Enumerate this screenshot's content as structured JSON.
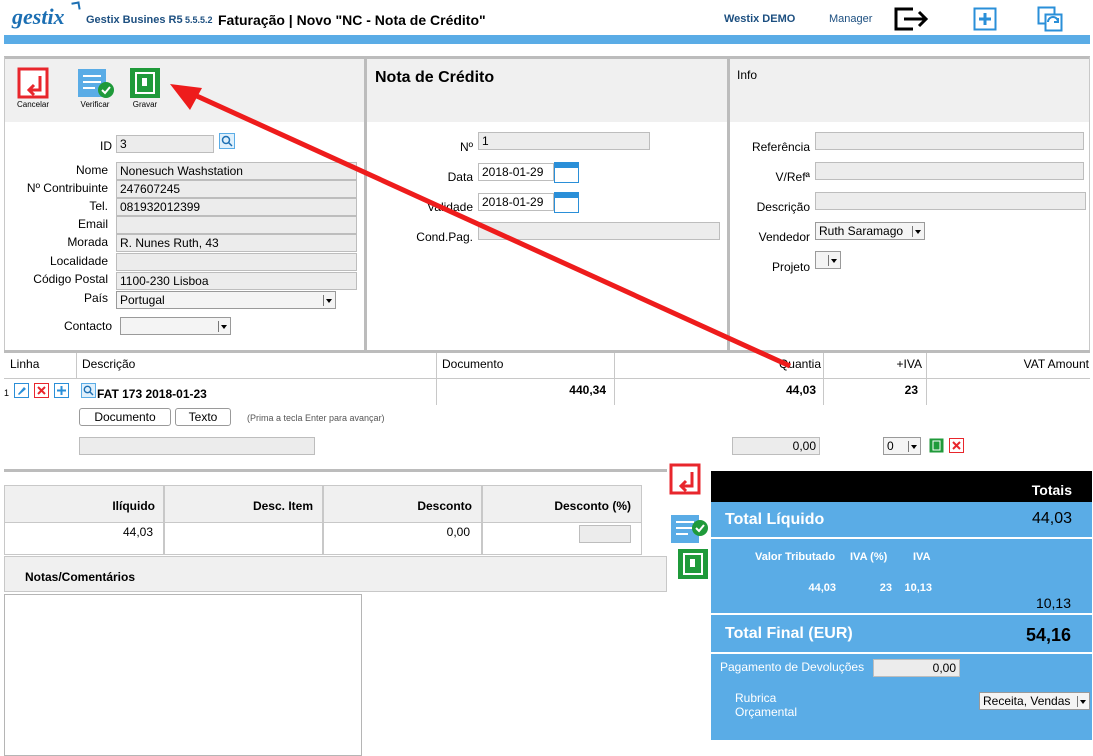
{
  "header": {
    "logo": "gestix",
    "app_name": "Gestix Busines R5",
    "version": "5.5.5.2",
    "title": "Faturação | Novo \"NC - Nota de Crédito\"",
    "company": "Westix DEMO",
    "user": "Manager"
  },
  "toolbar": {
    "cancel_label": "Cancelar",
    "verify_label": "Verificar",
    "save_label": "Gravar"
  },
  "doc_section": {
    "title": "Nota de Crédito"
  },
  "info_section": {
    "title": "Info"
  },
  "customer": {
    "id_label": "ID",
    "id_value": "3",
    "name_label": "Nome",
    "name_value": "Nonesuch Washstation",
    "nif_label": "Nº Contribuinte",
    "nif_value": "247607245",
    "tel_label": "Tel.",
    "tel_value": "081932012399",
    "email_label": "Email",
    "email_value": "",
    "address_label": "Morada",
    "address_value": "R. Nunes Ruth, 43",
    "city_label": "Localidade",
    "city_value": "",
    "zip_label": "Código Postal",
    "zip_value": "1100-230 Lisboa",
    "country_label": "País",
    "country_value": "Portugal",
    "contact_label": "Contacto",
    "contact_value": ""
  },
  "document": {
    "number_label": "Nº",
    "number_value": "1",
    "date_label": "Data",
    "date_value": "2018-01-29",
    "validity_label": "Validade",
    "validity_value": "2018-01-29",
    "payment_label": "Cond.Pag.",
    "payment_value": ""
  },
  "info": {
    "reference_label": "Referência",
    "vref_label": "V/Refª",
    "description_label": "Descrição",
    "seller_label": "Vendedor",
    "seller_value": "Ruth Saramago",
    "project_label": "Projeto",
    "project_value": ""
  },
  "lines": {
    "headers": {
      "line": "Linha",
      "description": "Descrição",
      "document": "Documento",
      "quantity": "Quantia",
      "vat": "+IVA",
      "vat_amount": "VAT Amount"
    },
    "rows": [
      {
        "number": "1",
        "description": "FAT 173 2018-01-23",
        "document": "440,34",
        "quantity": "44,03",
        "vat": "23"
      }
    ],
    "doc_button": "Documento",
    "text_button": "Texto",
    "hint": "(Prima a tecla Enter para avançar)",
    "new_amount": "0,00",
    "new_vat": "0"
  },
  "summary": {
    "headers": {
      "net": "Ilíquido",
      "item_disc": "Desc. Item",
      "discount": "Desconto",
      "discount_pct": "Desconto (%)"
    },
    "net": "44,03",
    "item_disc": "",
    "discount": "0,00",
    "notes_label": "Notas/Comentários"
  },
  "totals": {
    "title": "Totais",
    "net_label": "Total Líquido",
    "net_value": "44,03",
    "taxed_label": "Valor Tributado",
    "vat_pct_label": "IVA (%)",
    "vat_label": "IVA",
    "taxed_value": "44,03",
    "vat_pct_value": "23",
    "vat_value": "10,13",
    "vat_total": "10,13",
    "final_label": "Total Final (EUR)",
    "final_value": "54,16",
    "refund_label": "Pagamento de Devoluções",
    "refund_value": "0,00",
    "budget_label_1": "Rubrica",
    "budget_label_2": "Orçamental",
    "budget_value": "Receita, Vendas"
  },
  "colors": {
    "accent": "#5aace6",
    "dark": "#000000",
    "cancel": "#e8262c",
    "save": "#1f9a3a",
    "arrow": "#ee1c1c"
  }
}
